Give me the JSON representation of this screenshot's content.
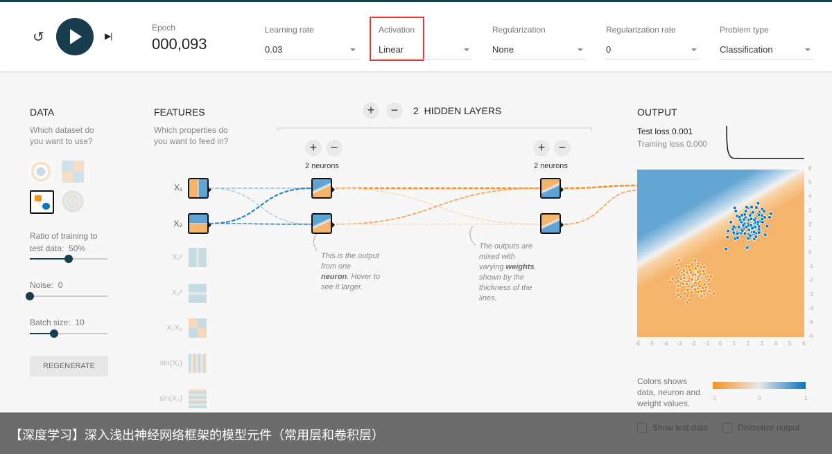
{
  "header": {
    "reset_icon": "reset-icon",
    "play_icon": "play-icon",
    "step_icon": "step-forward-icon",
    "epoch_label": "Epoch",
    "epoch_value": "000,093",
    "dropdowns": [
      {
        "label": "Learning rate",
        "value": "0.03"
      },
      {
        "label": "Activation",
        "value": "Linear",
        "highlighted": true
      },
      {
        "label": "Regularization",
        "value": "None"
      },
      {
        "label": "Regularization rate",
        "value": "0"
      },
      {
        "label": "Problem type",
        "value": "Classification"
      }
    ],
    "highlight_color": "#e53935"
  },
  "data": {
    "title": "DATA",
    "subtitle_1": "Which dataset do",
    "subtitle_2": "you want to use?",
    "datasets": [
      "circle",
      "xor",
      "gaussian",
      "spiral"
    ],
    "selected_dataset": "gaussian",
    "ratio_label": "Ratio of training to",
    "ratio_label_2": "test data:",
    "ratio_value": "50%",
    "ratio_fraction": 0.5,
    "noise_label": "Noise:",
    "noise_value": "0",
    "noise_fraction": 0,
    "batch_label": "Batch size:",
    "batch_value": "10",
    "batch_fraction": 0.3,
    "regenerate": "REGENERATE"
  },
  "features": {
    "title": "FEATURES",
    "subtitle_1": "Which properties do",
    "subtitle_2": "you want to feed in?",
    "items": [
      {
        "label": "X₁",
        "active": true
      },
      {
        "label": "X₂",
        "active": true
      },
      {
        "label": "X₁²",
        "active": false
      },
      {
        "label": "X₂²",
        "active": false
      },
      {
        "label": "X₁X₂",
        "active": false
      },
      {
        "label": "sin(X₁)",
        "active": false
      },
      {
        "label": "sin(X₂)",
        "active": false
      }
    ]
  },
  "network": {
    "add": "+",
    "remove": "−",
    "layer_count": "2",
    "layers_label": "HIDDEN LAYERS",
    "layer1_neurons": "2 neurons",
    "layer2_neurons": "2 neurons",
    "note1_a": "This is the output",
    "note1_b": "from one",
    "note1_bold": "neuron",
    "note1_c": ". Hover to",
    "note1_d": "see it larger.",
    "note2_a": "The outputs are",
    "note2_b": "mixed with",
    "note2_c": "varying ",
    "note2_bold": "weights",
    "note2_d": ",",
    "note2_e": "shown by the",
    "note2_f": "thickness of the",
    "note2_g": "lines."
  },
  "output": {
    "title": "OUTPUT",
    "test_loss_label": "Test loss",
    "test_loss": "0.001",
    "train_loss_label": "Training loss",
    "train_loss": "0.000",
    "axis_ticks": [
      "-6",
      "-5",
      "-4",
      "-3",
      "-2",
      "-1",
      "0",
      "1",
      "2",
      "3",
      "4",
      "5",
      "6"
    ],
    "legend_text_1": "Colors shows",
    "legend_text_2": "data, neuron and",
    "legend_text_3": "weight values.",
    "legend_min": "-1",
    "legend_mid": "0",
    "legend_max": "1",
    "show_test_data": "Show test data",
    "discretize_output": "Discretize output",
    "colors": {
      "negative": "#f59322",
      "positive": "#0877bd"
    }
  },
  "overlay_caption": "【深度学习】深入浅出神经网络框架的模型元件（常用层和卷积层）"
}
